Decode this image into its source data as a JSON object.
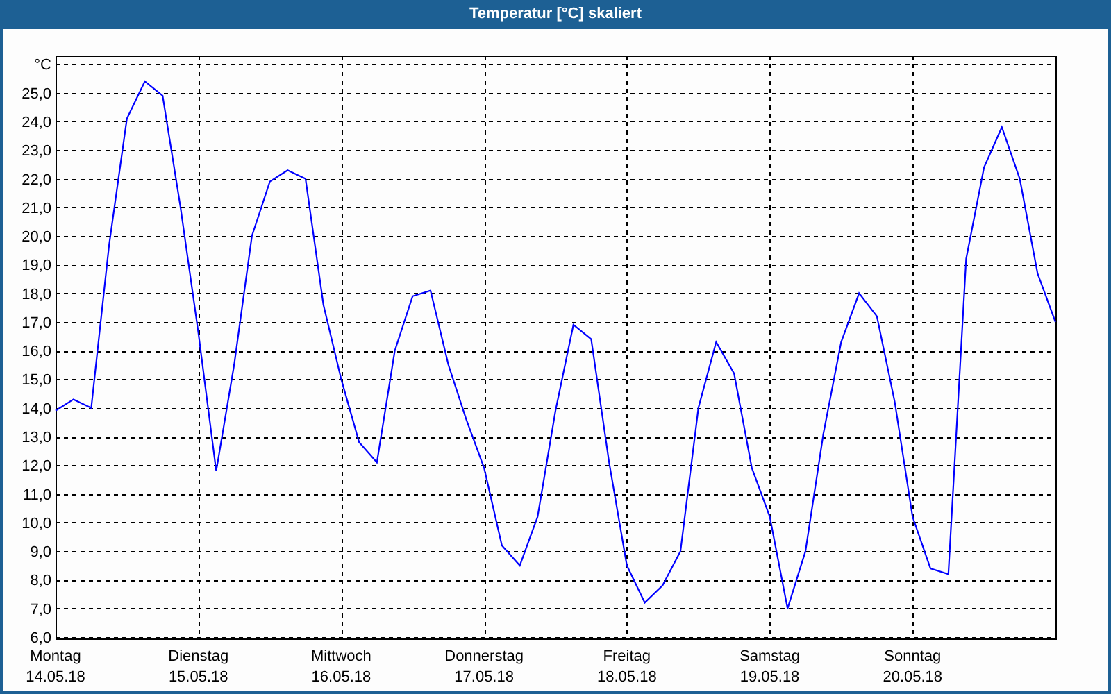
{
  "window": {
    "title": "Temperatur [°C] skaliert"
  },
  "chart": {
    "chart_data": {
      "type": "line",
      "grid": true,
      "ylim": [
        6,
        26.3
      ],
      "categories": [
        "Montag\n14.05.18",
        null,
        null,
        null,
        null,
        null,
        null,
        null,
        "Dienstag\n15.05.18",
        null,
        null,
        null,
        null,
        null,
        null,
        null,
        "Mittwoch\n16.05.18",
        null,
        null,
        null,
        null,
        null,
        null,
        null,
        "Donnerstag\n17.05.18",
        null,
        null,
        null,
        null,
        null,
        null,
        null,
        "Freitag\n18.05.18",
        null,
        null,
        null,
        null,
        null,
        null,
        null,
        "Samstag\n19.05.18",
        null,
        null,
        null,
        null,
        null,
        null,
        null,
        "Sonntag\n20.05.18",
        null,
        null,
        null,
        null,
        null,
        null,
        null,
        null
      ],
      "series": [
        {
          "color": "#0000ff",
          "values": [
            13.9,
            14.3,
            14.0,
            19.7,
            24.1,
            25.4,
            24.9,
            21.0,
            16.6,
            11.8,
            15.5,
            20.0,
            21.9,
            22.3,
            22.0,
            17.6,
            15.0,
            12.8,
            12.1,
            16.0,
            17.9,
            18.1,
            15.5,
            13.6,
            11.9,
            9.2,
            8.5,
            10.2,
            13.9,
            16.9,
            16.4,
            12.1,
            8.5,
            7.2,
            7.8,
            9.0,
            14.0,
            16.3,
            15.2,
            11.9,
            10.2,
            7.0,
            9.0,
            13.1,
            16.3,
            18.0,
            17.2,
            14.2,
            10.2,
            8.4,
            8.2,
            19.2,
            22.4,
            23.8,
            22.0,
            18.7,
            17.0
          ]
        }
      ],
      "yticks": [
        {
          "value": 6,
          "label": "6,0"
        },
        {
          "value": 7,
          "label": "7,0"
        },
        {
          "value": 8,
          "label": "8,0"
        },
        {
          "value": 9,
          "label": "9,0"
        },
        {
          "value": 10,
          "label": "10,0"
        },
        {
          "value": 11,
          "label": "11,0"
        },
        {
          "value": 12,
          "label": "12,0"
        },
        {
          "value": 13,
          "label": "13,0"
        },
        {
          "value": 14,
          "label": "14,0"
        },
        {
          "value": 15,
          "label": "15,0"
        },
        {
          "value": 16,
          "label": "16,0"
        },
        {
          "value": 17,
          "label": "17,0"
        },
        {
          "value": 18,
          "label": "18,0"
        },
        {
          "value": 19,
          "label": "19,0"
        },
        {
          "value": 20,
          "label": "20,0"
        },
        {
          "value": 21,
          "label": "21,0"
        },
        {
          "value": 22,
          "label": "22,0"
        },
        {
          "value": 23,
          "label": "23,0"
        },
        {
          "value": 24,
          "label": "24,0"
        },
        {
          "value": 25,
          "label": "25,0"
        },
        {
          "value": 26,
          "label": "°C"
        }
      ]
    }
  }
}
